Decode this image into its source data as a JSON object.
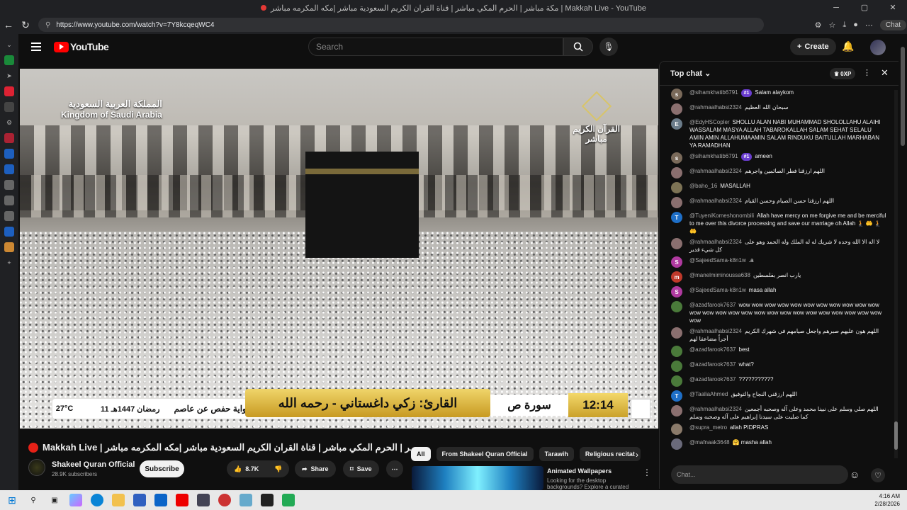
{
  "browser": {
    "window_title": "مكة مباشر | الحرم المكي مباشر | قناة القران الكريم السعودية مباشر |مكه المكرمه مباشر | Makkah Live - YouTube",
    "url": "https://www.youtube.com/watch?v=7Y8kcqeqWC4",
    "chat_button": "Chat"
  },
  "header": {
    "logo_text": "YouTube",
    "search_placeholder": "Search",
    "create_label": "Create"
  },
  "video": {
    "overlay_kingdom_ar": "المملكة العربية السعودية",
    "overlay_kingdom_en": "Kingdom of Saudi Arabia",
    "overlay_channel_ar": "القرآن الكريم",
    "overlay_channel_sub_ar": "مباشر",
    "temp": "27°C",
    "hijri_date": "11 رمضان 1447هـ",
    "riwaya": "رواية حفص عن عاصم",
    "reciter": "القارئ: زكي داغستاني - رحمه الله",
    "surah": "سورة ص",
    "time": "12:14"
  },
  "info": {
    "title": "Makkah Live | مكة مباشر | الحرم المكي مباشر | قناة القران الكريم السعودية مباشر |مكه المكرمه مباشر",
    "channel": "Shakeel Quran Official",
    "subscribers": "28.9K subscribers",
    "subscribe": "Subscribe",
    "likes": "8.7K",
    "share": "Share",
    "save": "Save"
  },
  "chips": [
    "All",
    "From Shakeel Quran Official",
    "Tarawih",
    "Religious recitat"
  ],
  "recommendation": {
    "title": "Animated Wallpapers",
    "desc": "Looking for the desktop backgrounds? Explore a curated"
  },
  "chat": {
    "mode": "Top chat",
    "points": "0XP",
    "input_placeholder": "Chat...",
    "messages": [
      {
        "user": "@sihamkhatib6791",
        "badge": "#1",
        "text": "Salam alaykom",
        "color": "#7a6a5a",
        "initial": "s"
      },
      {
        "user": "@rahmaalhabsi2324",
        "badge": "",
        "text": "سبحان الله العظيم",
        "color": "#8a6f6f",
        "initial": ""
      },
      {
        "user": "@EdyHSCopler",
        "badge": "",
        "text": "SHOLLU ALAN NABI MUHAMMAD SHOLOLLAHU ALAIHI WASSALAM MASYA ALLAH TABAROKALLAH SALAM SEHAT SELALU AMIN AMIN ALLAHUMAAMIN SALAM RINDUKU BAITULLAH MARHABAN YA RAMADHAN",
        "color": "#6b7c8a",
        "initial": "E"
      },
      {
        "user": "@sihamkhatib6791",
        "badge": "#1",
        "text": "ameen",
        "color": "#7a6a5a",
        "initial": "s"
      },
      {
        "user": "@rahmaalhabsi2324",
        "badge": "",
        "text": "اللهم ارزقنا فطر الصائمين واجرهم",
        "color": "#8a6f6f",
        "initial": ""
      },
      {
        "user": "@baho_16",
        "badge": "",
        "text": "MASALLAH",
        "color": "#7d7355",
        "initial": ""
      },
      {
        "user": "@rahmaalhabsi2324",
        "badge": "",
        "text": "اللهم ارزقنا حسن الصيام وحسن القيام",
        "color": "#8a6f6f",
        "initial": ""
      },
      {
        "user": "@TuyeniKomeshonombili",
        "badge": "",
        "text": "Allah have mercy on me forgive me and be merciful to me over this divorce processing and save our marriage oh Allah 🧎 🤲 🧎 🤲",
        "color": "#1e6fc8",
        "initial": "T"
      },
      {
        "user": "@rahmaalhabsi2324",
        "badge": "",
        "text": "لا اله الا الله وحده لا شريك له له الملك وله الحمد وهو على كل شيء قدير",
        "color": "#8a6f6f",
        "initial": ""
      },
      {
        "user": "@SajeedSama-k8n1w",
        "badge": "",
        "text": ".a",
        "color": "#b03aa0",
        "initial": "S"
      },
      {
        "user": "@manelmiminoussa638",
        "badge": "",
        "text": "يارب انصر بفلسطين",
        "color": "#c0392b",
        "initial": "m"
      },
      {
        "user": "@SajeedSama-k8n1w",
        "badge": "",
        "text": "masa allah",
        "color": "#b03aa0",
        "initial": "S"
      },
      {
        "user": "@azadfarook7637",
        "badge": "",
        "text": "wow wow wow wow wow wow wow wow wow wow wow wow wow wow wow wow wow wow wow wow wow wow wow wow wow wow wow",
        "color": "#4a7a3a",
        "initial": ""
      },
      {
        "user": "@rahmaalhabsi2324",
        "badge": "",
        "text": "اللهم هون عليهم صبرهم واجعل صيامهم في شهرك الكريم أجراً مضاعفا لهم",
        "color": "#8a6f6f",
        "initial": ""
      },
      {
        "user": "@azadfarook7637",
        "badge": "",
        "text": "best",
        "color": "#4a7a3a",
        "initial": ""
      },
      {
        "user": "@azadfarook7637",
        "badge": "",
        "text": "what?",
        "color": "#4a7a3a",
        "initial": ""
      },
      {
        "user": "@azadfarook7637",
        "badge": "",
        "text": "???????????",
        "color": "#4a7a3a",
        "initial": ""
      },
      {
        "user": "@TaaliaAhmed",
        "badge": "",
        "text": "اللهم ارزقني النجاح والتوفيق",
        "color": "#1e6fc8",
        "initial": "T"
      },
      {
        "user": "@rahmaalhabsi2324",
        "badge": "",
        "text": "اللهم صلي وسلم على نبينا محمد وعلى آله وصحبه أجمعين كما صليت على سيدنا إبراهيم على آله وصحبه وسلم",
        "color": "#8a6f6f",
        "initial": ""
      },
      {
        "user": "@supra_metro",
        "badge": "",
        "text": "allah PIDPRAS",
        "color": "#8a7a6a",
        "initial": ""
      },
      {
        "user": "@mafnaak3648",
        "badge": "",
        "text": "🤗 masha allah",
        "color": "#6a6a7a",
        "initial": ""
      }
    ]
  },
  "taskbar": {
    "time": "4:16 AM",
    "date": "2/28/2026"
  }
}
